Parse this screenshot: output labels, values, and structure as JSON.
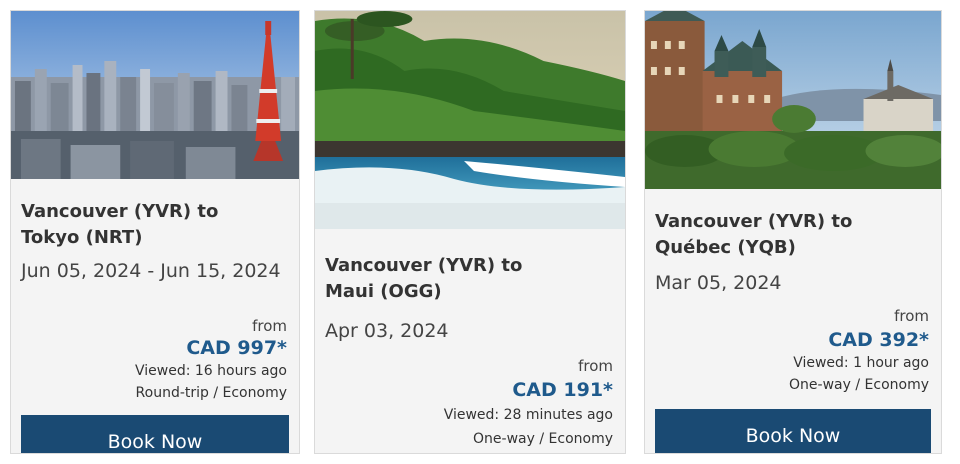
{
  "cards": [
    {
      "image": "tokyo-city-skyline",
      "route_line1": "Vancouver (YVR) to",
      "route_line2": "Tokyo (NRT)",
      "dates": "Jun 05, 2024 - Jun 15, 2024",
      "from_label": "from",
      "price": "CAD 997*",
      "viewed": "Viewed: 16 hours ago",
      "trip": "Round-trip / Economy",
      "button": "Book Now"
    },
    {
      "image": "maui-coast-waves",
      "route_line1": "Vancouver (YVR) to",
      "route_line2": "Maui (OGG)",
      "dates": "Apr 03, 2024",
      "from_label": "from",
      "price": "CAD 191*",
      "viewed": "Viewed: 28 minutes ago",
      "trip": "One-way / Economy"
    },
    {
      "image": "quebec-chateau-frontenac",
      "route_line1": "Vancouver (YVR) to",
      "route_line2": "Québec (YQB)",
      "dates": "Mar 05, 2024",
      "from_label": "from",
      "price": "CAD 392*",
      "viewed": "Viewed: 1 hour ago",
      "trip": "One-way / Economy",
      "button": "Book Now"
    }
  ],
  "colors": {
    "price": "#1f5a8c",
    "button": "#1a4a73",
    "card_bg": "#f4f4f4"
  }
}
